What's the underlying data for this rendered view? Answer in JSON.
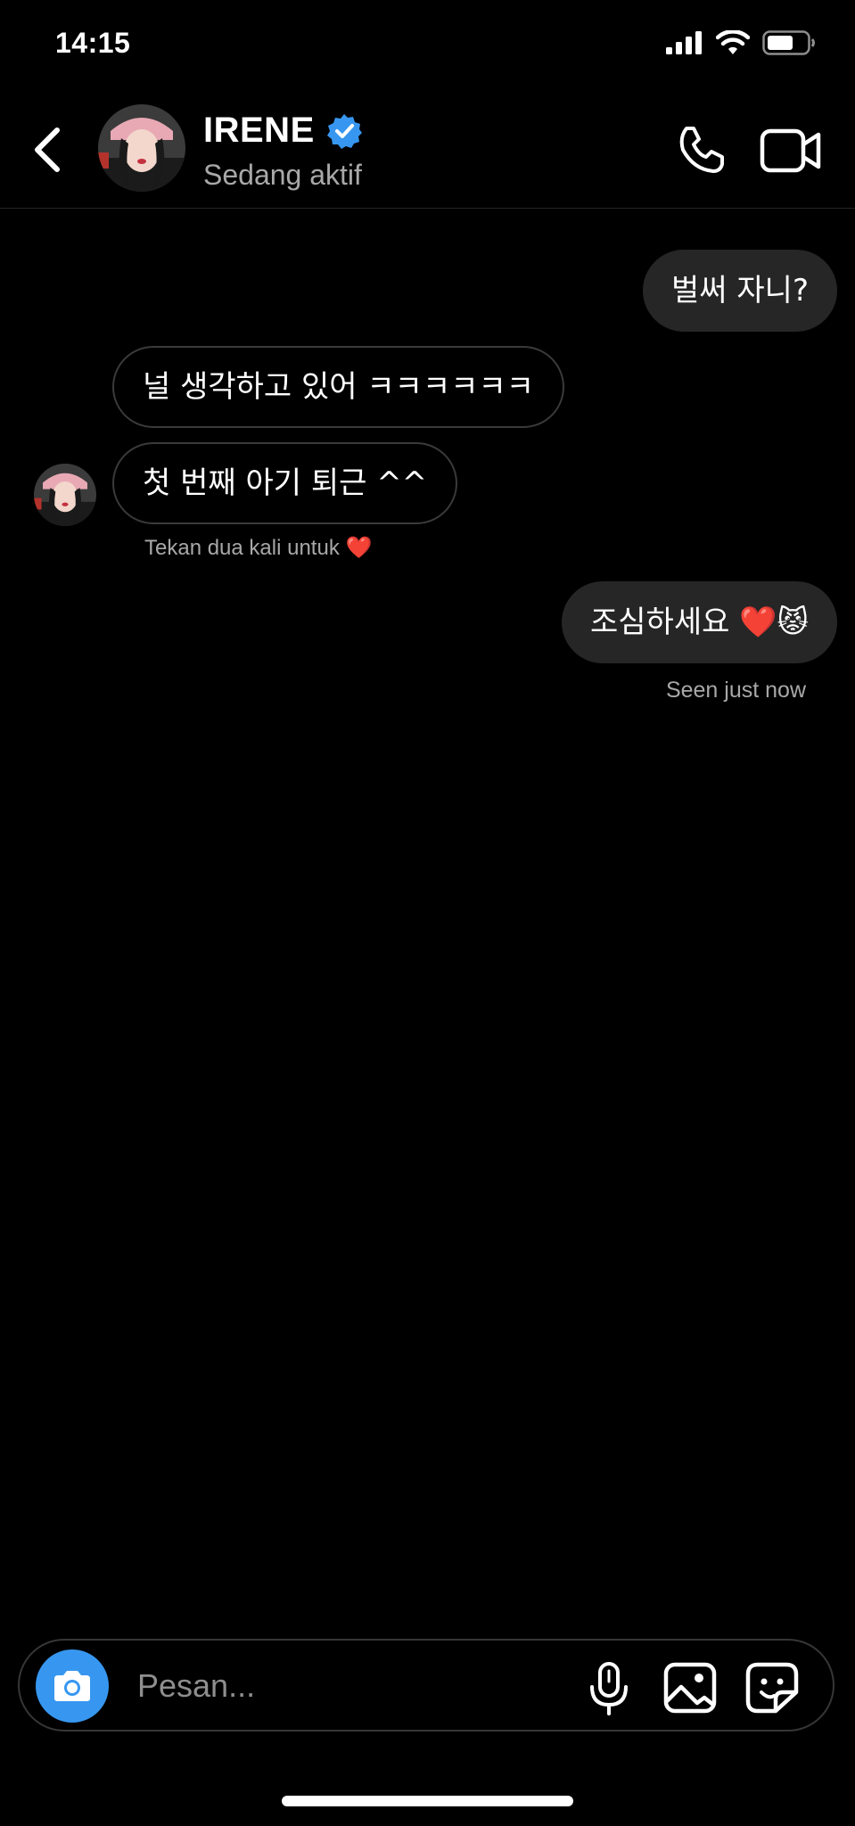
{
  "status_bar": {
    "time": "14:15"
  },
  "header": {
    "contact_name": "IRENE",
    "activity_status": "Sedang aktif"
  },
  "messages": [
    {
      "direction": "outgoing",
      "text": "벌써 자니?"
    },
    {
      "direction": "incoming",
      "text": "널 생각하고 있어 ㅋㅋㅋㅋㅋㅋ"
    },
    {
      "direction": "incoming",
      "text": "첫 번째 아기 퇴근 ^^"
    },
    {
      "direction": "outgoing",
      "text": "조심하세요 ❤️😾"
    }
  ],
  "double_tap_hint": "Tekan dua kali untuk",
  "hint_emoji": "❤️",
  "seen_status": "Seen just now",
  "composer": {
    "placeholder": "Pesan..."
  },
  "colors": {
    "background": "#000000",
    "outgoing_bubble": "#262626",
    "incoming_border": "#3a3a3a",
    "verified_badge": "#3797f0",
    "camera_button": "#3797f0",
    "secondary_text": "#a8a8a8"
  },
  "icons": [
    "signal-icon",
    "wifi-icon",
    "battery-icon",
    "back-arrow-icon",
    "verified-badge-icon",
    "phone-icon",
    "video-camera-icon",
    "camera-icon",
    "microphone-icon",
    "gallery-icon",
    "sticker-icon"
  ]
}
